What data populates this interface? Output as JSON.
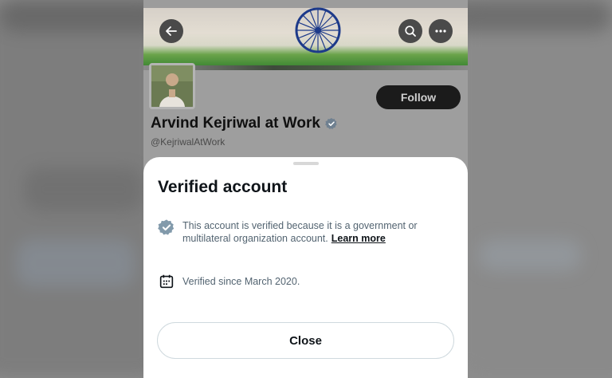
{
  "profile": {
    "name": "Arvind Kejriwal at Work",
    "handle": "@KejriwalAtWork",
    "follow_label": "Follow"
  },
  "header": {
    "back_icon": "arrow-left-icon",
    "search_icon": "search-icon",
    "more_icon": "more-horizontal-icon"
  },
  "sheet": {
    "title": "Verified account",
    "verified_text": "This account is verified because it is a government or multilateral organization account.",
    "learn_more_label": "Learn more",
    "since_text": "Verified since March 2020.",
    "close_label": "Close"
  },
  "colors": {
    "badge_gray": "#829aab",
    "button_dark": "#1b1b1b",
    "muted_text": "#536471"
  }
}
